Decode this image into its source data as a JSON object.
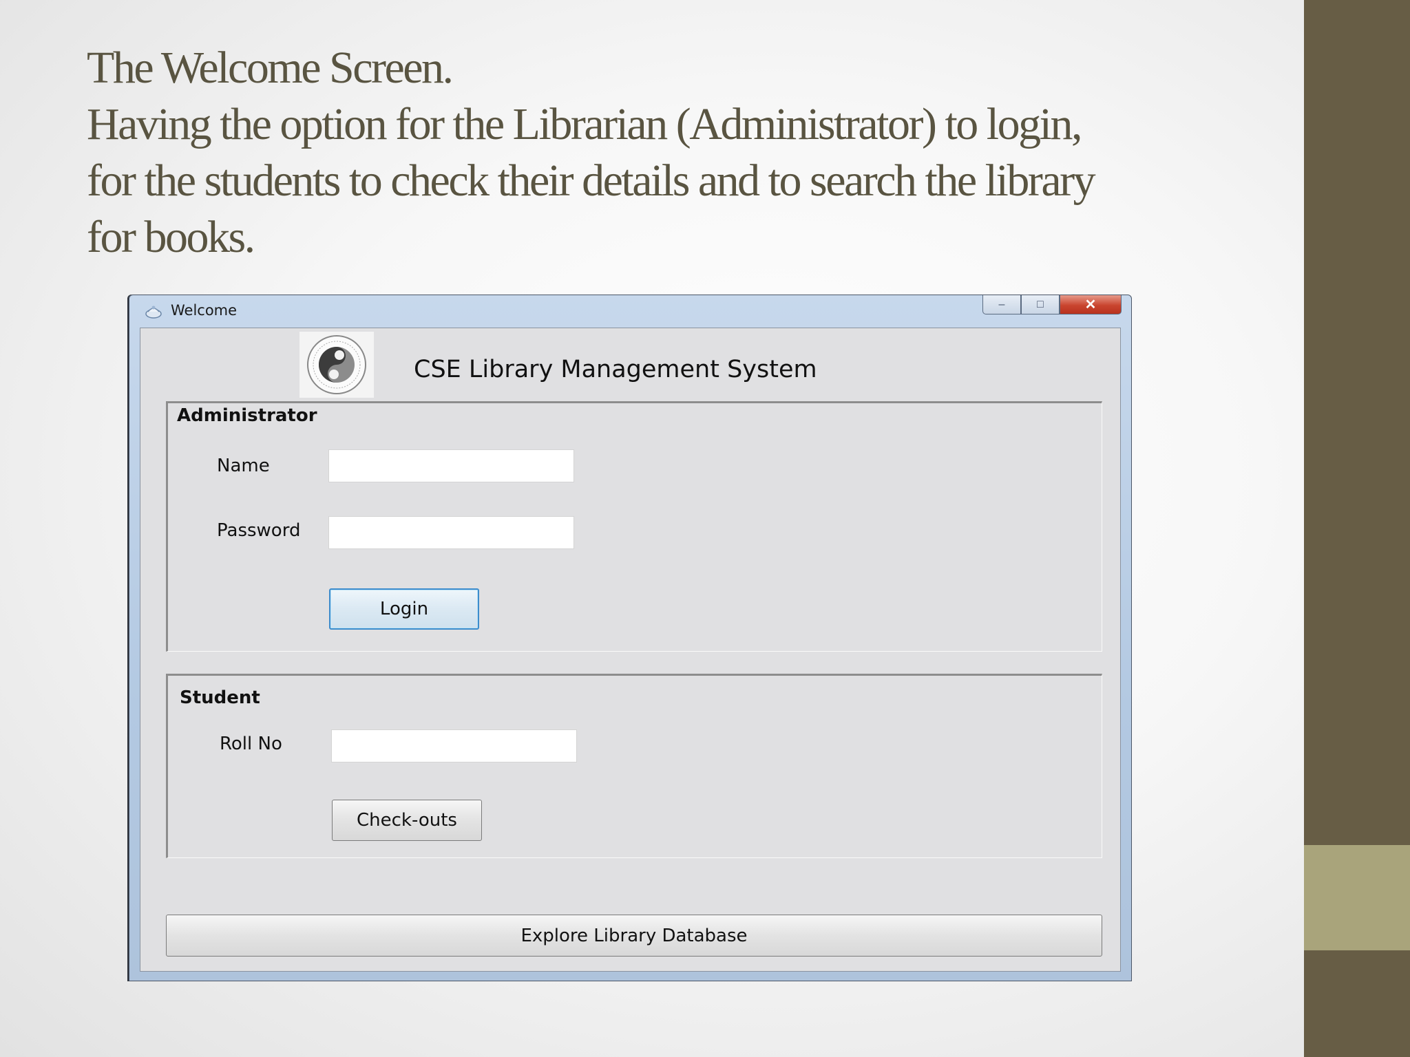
{
  "slide": {
    "title_lines": [
      "The Welcome Screen.",
      "Having the option for the Librarian (Administrator) to login,",
      "for  the students to check their details and to search the library",
      "for books."
    ]
  },
  "window": {
    "title": "Welcome",
    "controls": {
      "minimize": "–",
      "maximize": "□",
      "close": "✕"
    },
    "icon": "java-app-icon"
  },
  "app": {
    "logo": "institute-seal-logo",
    "heading": "CSE Library Management System"
  },
  "admin": {
    "group_label": "Administrator",
    "name_label": "Name",
    "name_value": "",
    "password_label": "Password",
    "password_value": "",
    "login_button": "Login"
  },
  "student": {
    "group_label": "Student",
    "rollno_label": "Roll No",
    "rollno_value": "",
    "checkouts_button": "Check-outs"
  },
  "explore_button": "Explore Library Database",
  "colors": {
    "side_band": "#675d45",
    "side_accent": "#a9a47b",
    "title_text": "#595441",
    "close_button": "#c9452f",
    "focus_border": "#3c8ccc"
  }
}
